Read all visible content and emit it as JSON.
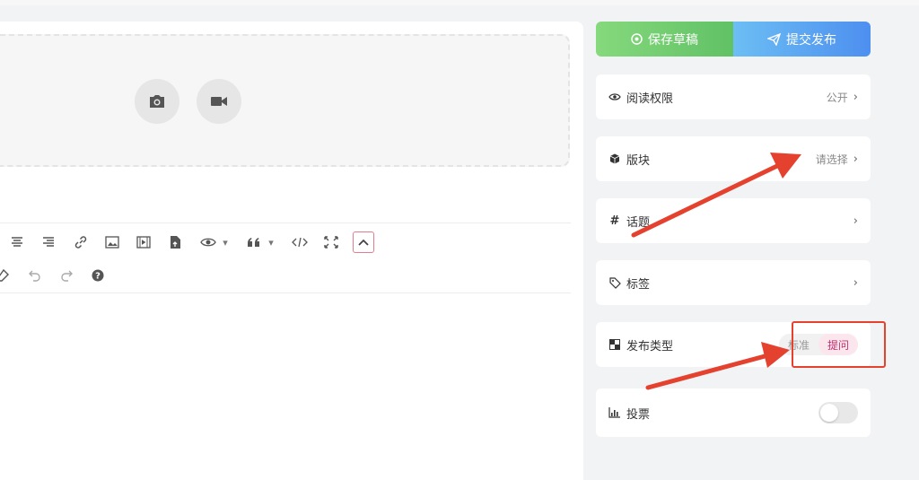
{
  "editor": {
    "upload": {
      "icons": [
        "camera-icon",
        "video-icon"
      ]
    },
    "toolbar": {
      "row1_icons": [
        "align-center-icon",
        "align-right-icon",
        "link-icon",
        "image-icon",
        "video-embed-icon",
        "file-upload-icon",
        "eye-icon",
        "quote-icon",
        "code-icon",
        "fullscreen-icon",
        "collapse-icon"
      ],
      "row2_icons": [
        "eraser-icon",
        "undo-icon",
        "redo-icon",
        "help-icon"
      ]
    }
  },
  "sidebar": {
    "save_label": "保存草稿",
    "publish_label": "提交发布",
    "read_permission": {
      "label": "阅读权限",
      "value": "公开"
    },
    "section": {
      "label": "版块",
      "value": "请选择"
    },
    "topic": {
      "label": "话题"
    },
    "tags": {
      "label": "标签"
    },
    "publish_type": {
      "label": "发布类型",
      "options": [
        "标准",
        "提问"
      ],
      "selected": "提问"
    },
    "vote": {
      "label": "投票",
      "enabled": false
    }
  },
  "colors": {
    "save": "#6cc96b",
    "publish": "#4d8fef",
    "annotation": "#e5412f",
    "accent": "#c2306f"
  }
}
